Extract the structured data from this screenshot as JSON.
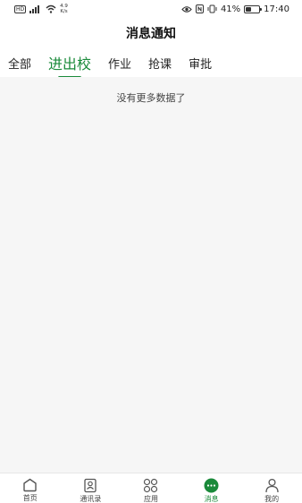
{
  "status_bar": {
    "network_speed_value": "4.9",
    "network_speed_unit": "K/s",
    "battery_percent": "41%",
    "battery_level": 0.41,
    "time": "17:40"
  },
  "header": {
    "title": "消息通知"
  },
  "tabs": [
    {
      "label": "全部",
      "active": false
    },
    {
      "label": "进出校",
      "active": true
    },
    {
      "label": "作业",
      "active": false
    },
    {
      "label": "抢课",
      "active": false
    },
    {
      "label": "审批",
      "active": false
    }
  ],
  "main": {
    "empty_text": "没有更多数据了"
  },
  "bottom_nav": [
    {
      "label": "首页",
      "icon": "home-icon",
      "active": false
    },
    {
      "label": "通讯录",
      "icon": "contacts-icon",
      "active": false
    },
    {
      "label": "应用",
      "icon": "apps-icon",
      "active": false
    },
    {
      "label": "消息",
      "icon": "message-icon",
      "active": true
    },
    {
      "label": "我的",
      "icon": "profile-icon",
      "active": false
    }
  ],
  "colors": {
    "accent": "#1a8a3a",
    "background": "#f6f6f6"
  }
}
